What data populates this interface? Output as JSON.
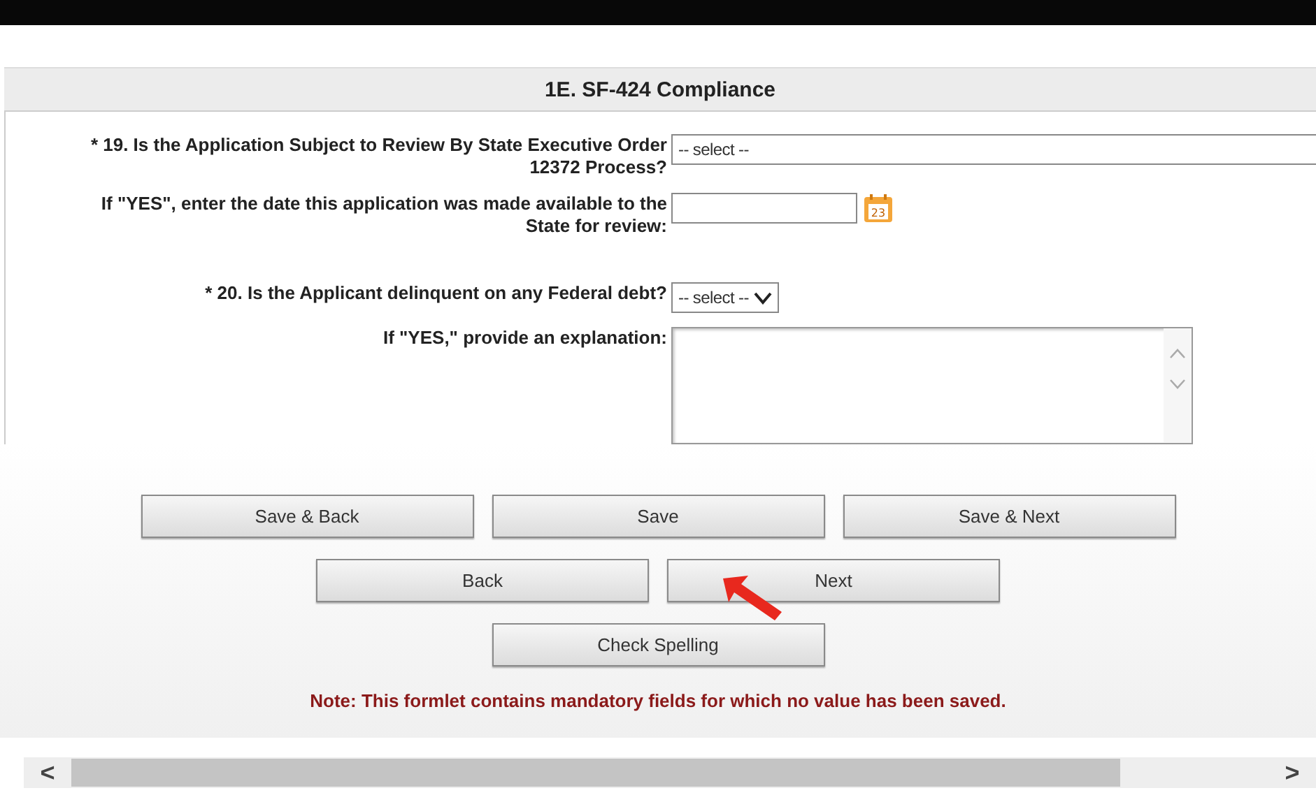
{
  "section": {
    "title": "1E. SF-424 Compliance"
  },
  "fields": [
    {
      "kind": "select-wide",
      "label": "* 19. Is the Application Subject to Review By State Executive Order 12372 Process?",
      "value": "-- select --"
    },
    {
      "kind": "date",
      "label": "If \"YES\", enter the date this application was made available to the State for review:",
      "calendar_day": "23"
    },
    {
      "kind": "select",
      "label": "* 20. Is the Applicant delinquent on any Federal debt?",
      "value": "-- select --"
    },
    {
      "kind": "textarea",
      "label": "If \"YES,\" provide an explanation:"
    }
  ],
  "button_rows": [
    [
      "Save & Back",
      "Save",
      "Save & Next"
    ],
    [
      "Back",
      "Next"
    ],
    [
      "Check Spelling"
    ]
  ],
  "note": "Note: This formlet contains mandatory fields for which no value has been saved.",
  "scrollbar": {
    "left": "<",
    "right": ">"
  }
}
